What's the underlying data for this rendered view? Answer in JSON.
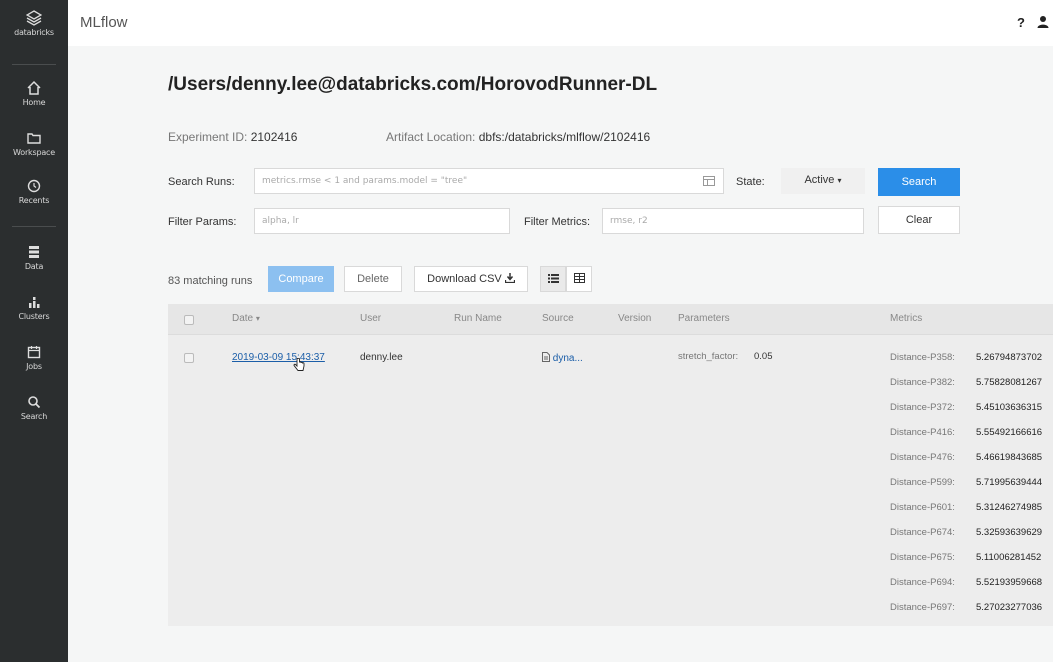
{
  "sidebar": {
    "brand": {
      "label": "databricks",
      "icon": "databricks-logo-icon"
    },
    "items": [
      {
        "label": "Home",
        "icon": "home-icon"
      },
      {
        "label": "Workspace",
        "icon": "folder-icon"
      },
      {
        "label": "Recents",
        "icon": "clock-icon"
      },
      {
        "label": "Data",
        "icon": "database-icon"
      },
      {
        "label": "Clusters",
        "icon": "clusters-icon"
      },
      {
        "label": "Jobs",
        "icon": "calendar-icon"
      },
      {
        "label": "Search",
        "icon": "search-icon"
      }
    ]
  },
  "header": {
    "app_name": "MLflow",
    "help_label": "?",
    "user_icon": "user-icon"
  },
  "experiment": {
    "title": "/Users/denny.lee@databricks.com/HorovodRunner-DL",
    "id_label": "Experiment ID:",
    "id_value": "2102416",
    "artifact_label": "Artifact Location:",
    "artifact_value": "dbfs:/databricks/mlflow/2102416"
  },
  "search": {
    "runs_label": "Search Runs:",
    "runs_placeholder": "metrics.rmse < 1 and params.model = \"tree\"",
    "state_label": "State:",
    "state_value": "Active",
    "search_button": "Search",
    "filter_params_label": "Filter Params:",
    "filter_params_placeholder": "alpha, lr",
    "filter_metrics_label": "Filter Metrics:",
    "filter_metrics_placeholder": "rmse, r2",
    "clear_button": "Clear"
  },
  "toolbar": {
    "matching_runs": "83 matching runs",
    "compare_label": "Compare",
    "delete_label": "Delete",
    "download_label": "Download CSV",
    "list_view_icon": "list-view-icon",
    "grid_view_icon": "grid-view-icon"
  },
  "table": {
    "headers": {
      "date": "Date",
      "user": "User",
      "run_name": "Run Name",
      "source": "Source",
      "version": "Version",
      "parameters": "Parameters",
      "metrics": "Metrics"
    },
    "row": {
      "date": "2019-03-09 15:43:37",
      "user": "denny.lee",
      "source": "dyna...",
      "param_key": "stretch_factor:",
      "param_value": "0.05"
    },
    "metrics": [
      {
        "key": "Distance-P358:",
        "value": "5.26794873702"
      },
      {
        "key": "Distance-P382:",
        "value": "5.75828081267"
      },
      {
        "key": "Distance-P372:",
        "value": "5.45103636315"
      },
      {
        "key": "Distance-P416:",
        "value": "5.55492166616"
      },
      {
        "key": "Distance-P476:",
        "value": "5.46619843685"
      },
      {
        "key": "Distance-P599:",
        "value": "5.71995639444"
      },
      {
        "key": "Distance-P601:",
        "value": "5.31246274985"
      },
      {
        "key": "Distance-P674:",
        "value": "5.32593639629"
      },
      {
        "key": "Distance-P675:",
        "value": "5.11006281452"
      },
      {
        "key": "Distance-P694:",
        "value": "5.52193959668"
      },
      {
        "key": "Distance-P697:",
        "value": "5.27023277036"
      }
    ]
  }
}
